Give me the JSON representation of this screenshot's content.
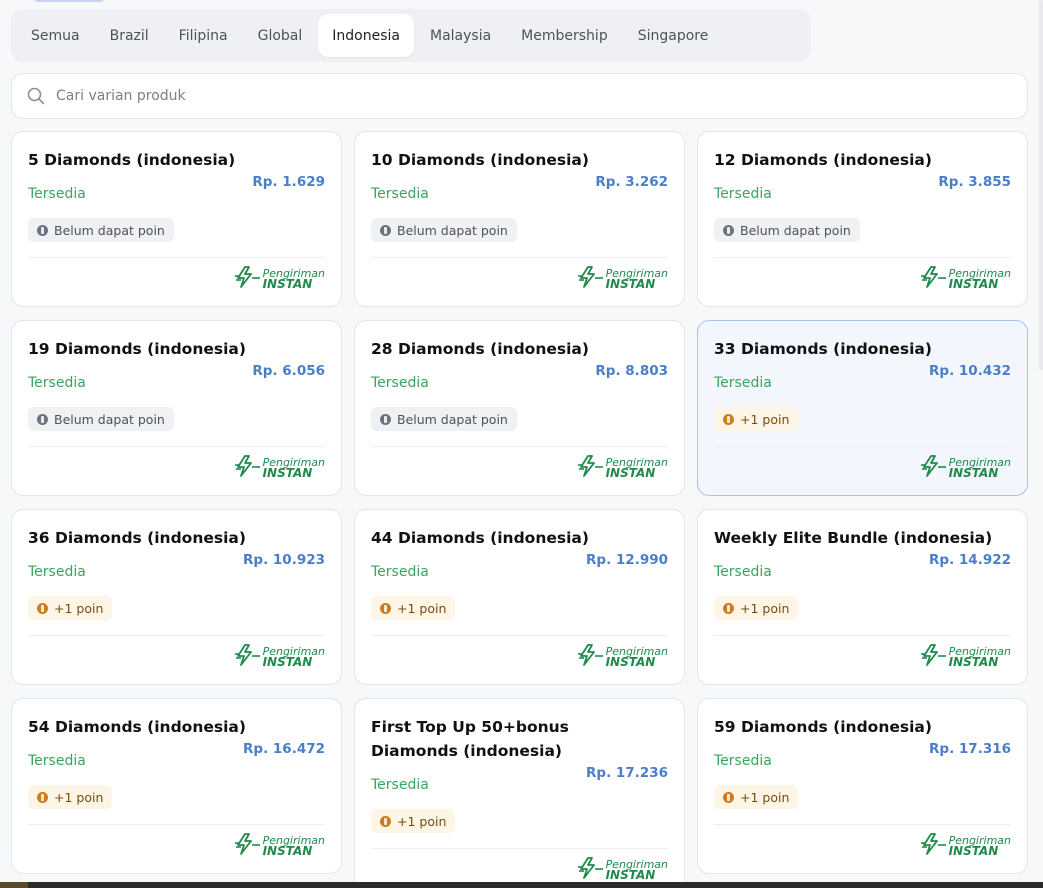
{
  "tabs": [
    {
      "label": "Semua",
      "active": false
    },
    {
      "label": "Brazil",
      "active": false
    },
    {
      "label": "Filipina",
      "active": false
    },
    {
      "label": "Global",
      "active": false
    },
    {
      "label": "Indonesia",
      "active": true
    },
    {
      "label": "Malaysia",
      "active": false
    },
    {
      "label": "Membership",
      "active": false
    },
    {
      "label": "Singapore",
      "active": false
    }
  ],
  "search": {
    "placeholder": "Cari varian produk",
    "icon": "search-icon"
  },
  "delivery": {
    "top": "Pengiriman",
    "bottom": "INSTAN",
    "color": "#1f8a4c"
  },
  "colors": {
    "status": "#3aa45e",
    "price": "#4a7fc8",
    "highlight_border": "#a9c4e6"
  },
  "products": [
    {
      "title": "5 Diamonds (indonesia)",
      "status": "Tersedia",
      "price": "Rp. 1.629",
      "badge": "Belum dapat poin",
      "badge_type": "none"
    },
    {
      "title": "10 Diamonds (indonesia)",
      "status": "Tersedia",
      "price": "Rp. 3.262",
      "badge": "Belum dapat poin",
      "badge_type": "none"
    },
    {
      "title": "12 Diamonds (indonesia)",
      "status": "Tersedia",
      "price": "Rp. 3.855",
      "badge": "Belum dapat poin",
      "badge_type": "none"
    },
    {
      "title": "19 Diamonds (indonesia)",
      "status": "Tersedia",
      "price": "Rp. 6.056",
      "badge": "Belum dapat poin",
      "badge_type": "none"
    },
    {
      "title": "28 Diamonds (indonesia)",
      "status": "Tersedia",
      "price": "Rp. 8.803",
      "badge": "Belum dapat poin",
      "badge_type": "none"
    },
    {
      "title": "33 Diamonds (indonesia)",
      "status": "Tersedia",
      "price": "Rp. 10.432",
      "badge": "+1 poin",
      "badge_type": "plus",
      "highlighted": true
    },
    {
      "title": "36 Diamonds (indonesia)",
      "status": "Tersedia",
      "price": "Rp. 10.923",
      "badge": "+1 poin",
      "badge_type": "plus"
    },
    {
      "title": "44 Diamonds (indonesia)",
      "status": "Tersedia",
      "price": "Rp. 12.990",
      "badge": "+1 poin",
      "badge_type": "plus"
    },
    {
      "title": "Weekly Elite Bundle (indonesia)",
      "status": "Tersedia",
      "price": "Rp. 14.922",
      "badge": "+1 poin",
      "badge_type": "plus"
    },
    {
      "title": "54 Diamonds (indonesia)",
      "status": "Tersedia",
      "price": "Rp. 16.472",
      "badge": "+1 poin",
      "badge_type": "plus"
    },
    {
      "title": "First Top Up 50+bonus Diamonds (indonesia)",
      "status": "Tersedia",
      "price": "Rp. 17.236",
      "badge": "+1 poin",
      "badge_type": "plus",
      "tall": true
    },
    {
      "title": "59 Diamonds (indonesia)",
      "status": "Tersedia",
      "price": "Rp. 17.316",
      "badge": "+1 poin",
      "badge_type": "plus"
    }
  ]
}
